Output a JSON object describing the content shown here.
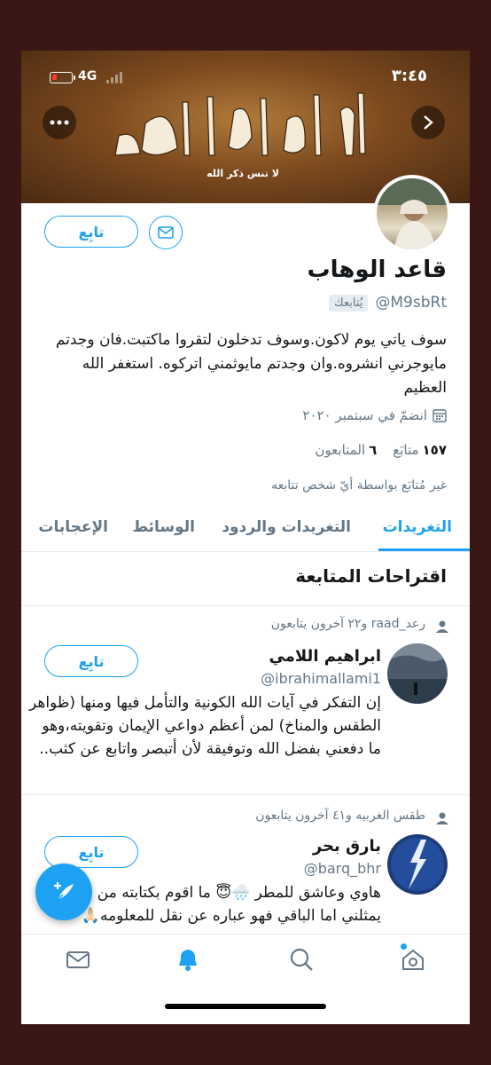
{
  "status_bar": {
    "time": "٣:٤٥",
    "network": "4G"
  },
  "banner": {
    "caption": "لا تنس ذكر الله"
  },
  "profile": {
    "name": "قاعد الوهاب",
    "handle": "@M9sbRt",
    "follows_you": "يُتابعك",
    "follow_label": "تابِع",
    "bio": "سوف ياتي يوم لاكون.وسوف تدخلون لتقروا ماكتبت.فان وجدتم مايوجرني انشروه.وان وجدتم مايوثمني اتركوه. استغفر الله العظيم",
    "joined": "انضمّ في سبتمبر ٢٠٢٠",
    "following_count": "١٥٧",
    "following_label": "متابَع",
    "followers_count": "٦",
    "followers_label": "المتابعون",
    "not_followed": "غير مُتابَع بواسطة أيّ شخص تتابعه"
  },
  "tabs": [
    "التغريدات",
    "التغريدات والردود",
    "الوسائط",
    "الإعجابات"
  ],
  "suggestions": {
    "title": "اقتراحات المتابعة",
    "items": [
      {
        "context": "رعد_raad و٢٢ آخرون يتابعون",
        "name": "ابراهيم اللامي",
        "handle": "@ibrahimallami1",
        "bio": "إن التفكر في آيات الله الكونية والتأمل فيها ومنها (ظواهر الطقس والمناخ) لمن أعظم دواعي الإيمان وتقويته،وهو ما دفعني بفضل الله وتوفيقة لأن أتبصر واتابع عن كثب..",
        "follow_label": "تابِع"
      },
      {
        "context": "طقس الغربيه و٤١ آخرون يتابعون",
        "name": "بارق بحر",
        "handle": "@barq_bhr",
        "bio": "هاوي وعاشق للمطر 🌧️😇 ما اقوم بكتابته من توقع فهو يمثلني اما الباقي فهو عباره عن نقل للمعلومه🙏🏻",
        "follow_label": "تابِع"
      }
    ]
  },
  "colors": {
    "accent": "#1da1f2",
    "text": "#14171a",
    "muted": "#657786"
  }
}
